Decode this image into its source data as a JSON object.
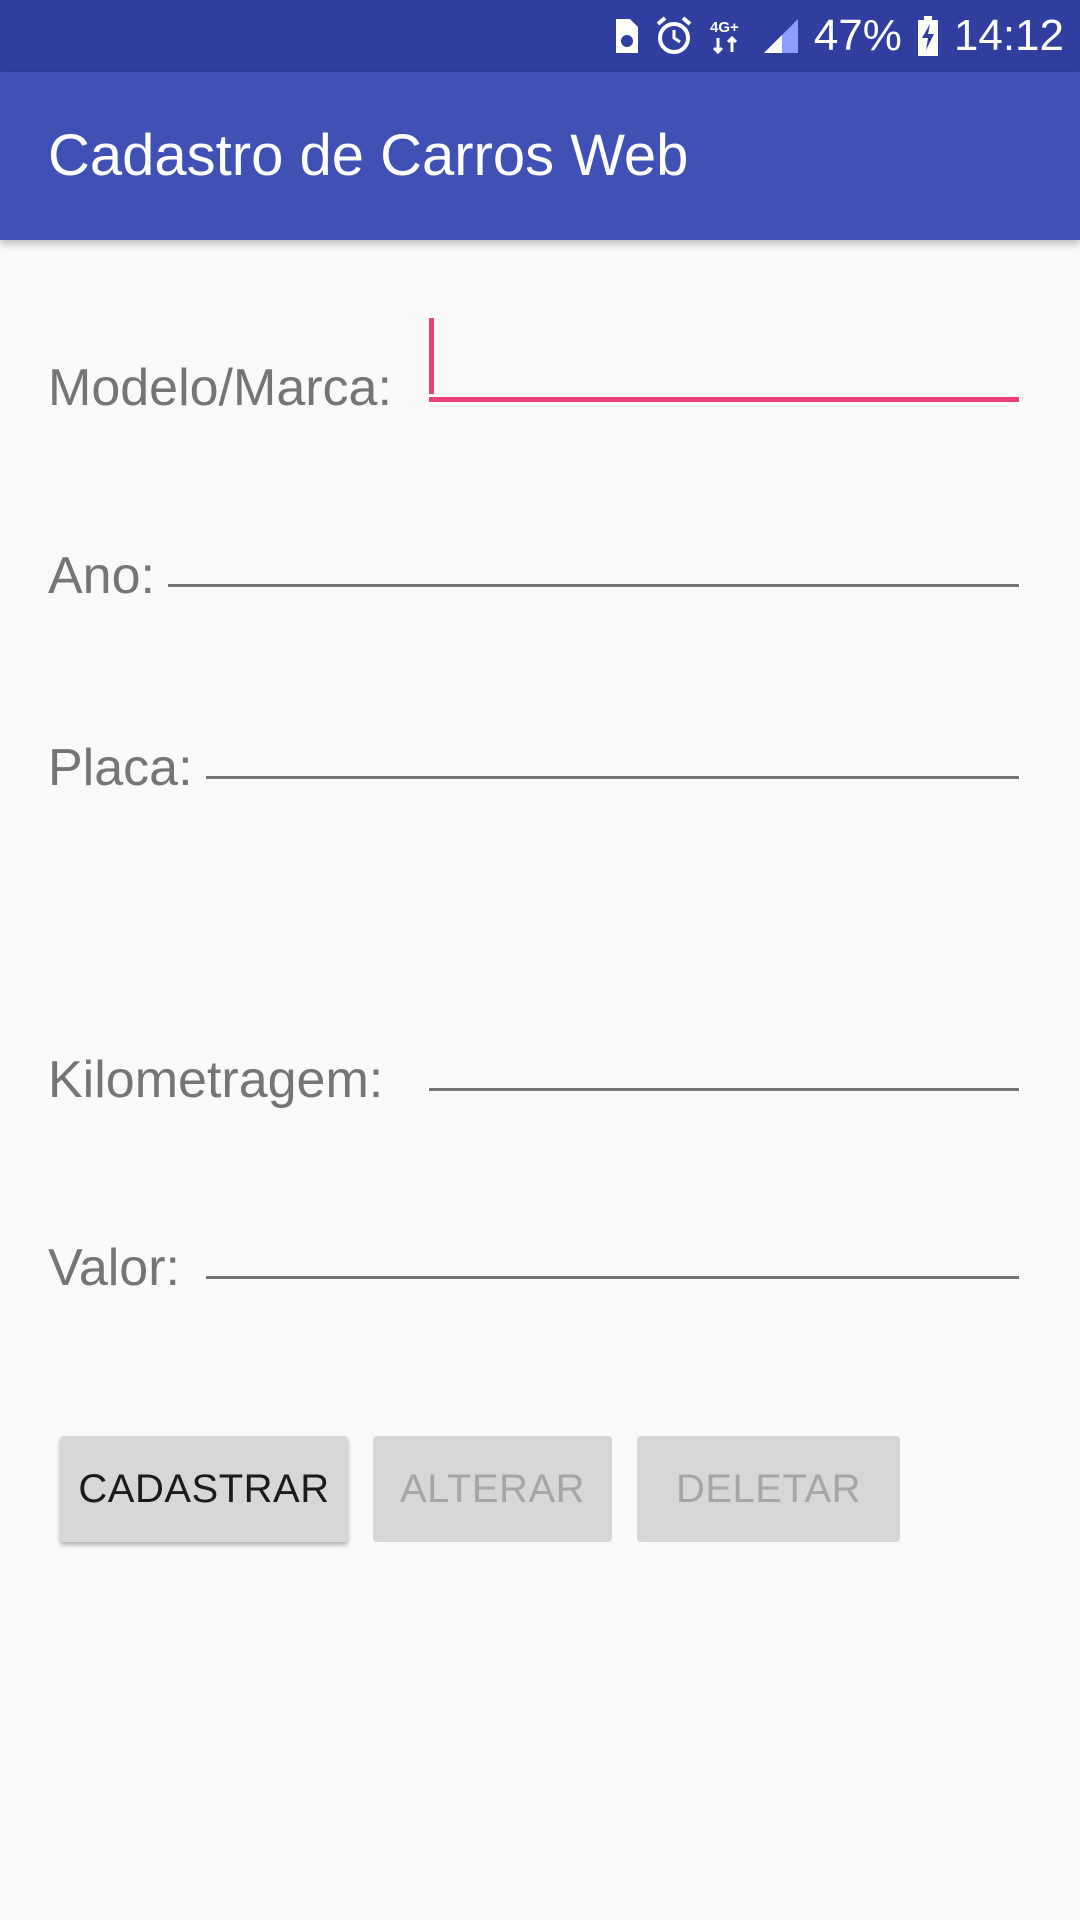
{
  "status_bar": {
    "battery_percent": "47%",
    "time": "14:12",
    "network": "4G+",
    "icons": [
      "sim-card-icon",
      "alarm-icon",
      "network-4g-icon",
      "signal-icon",
      "battery-charging-icon"
    ]
  },
  "toolbar": {
    "title": "Cadastro de Carros Web",
    "color": "#3f51b5"
  },
  "form": {
    "modelo": {
      "label": "Modelo/Marca:",
      "value": ""
    },
    "ano": {
      "label": "Ano:",
      "value": ""
    },
    "placa": {
      "label": "Placa:",
      "value": ""
    },
    "kilometragem": {
      "label": "Kilometragem:",
      "value": ""
    },
    "valor": {
      "label": "Valor:",
      "value": ""
    }
  },
  "buttons": {
    "cadastrar": "CADASTRAR",
    "alterar": "ALTERAR",
    "deletar": "DELETAR"
  },
  "colors": {
    "status_bar": "#303f9f",
    "accent": "#ec407a",
    "label": "#757575"
  }
}
